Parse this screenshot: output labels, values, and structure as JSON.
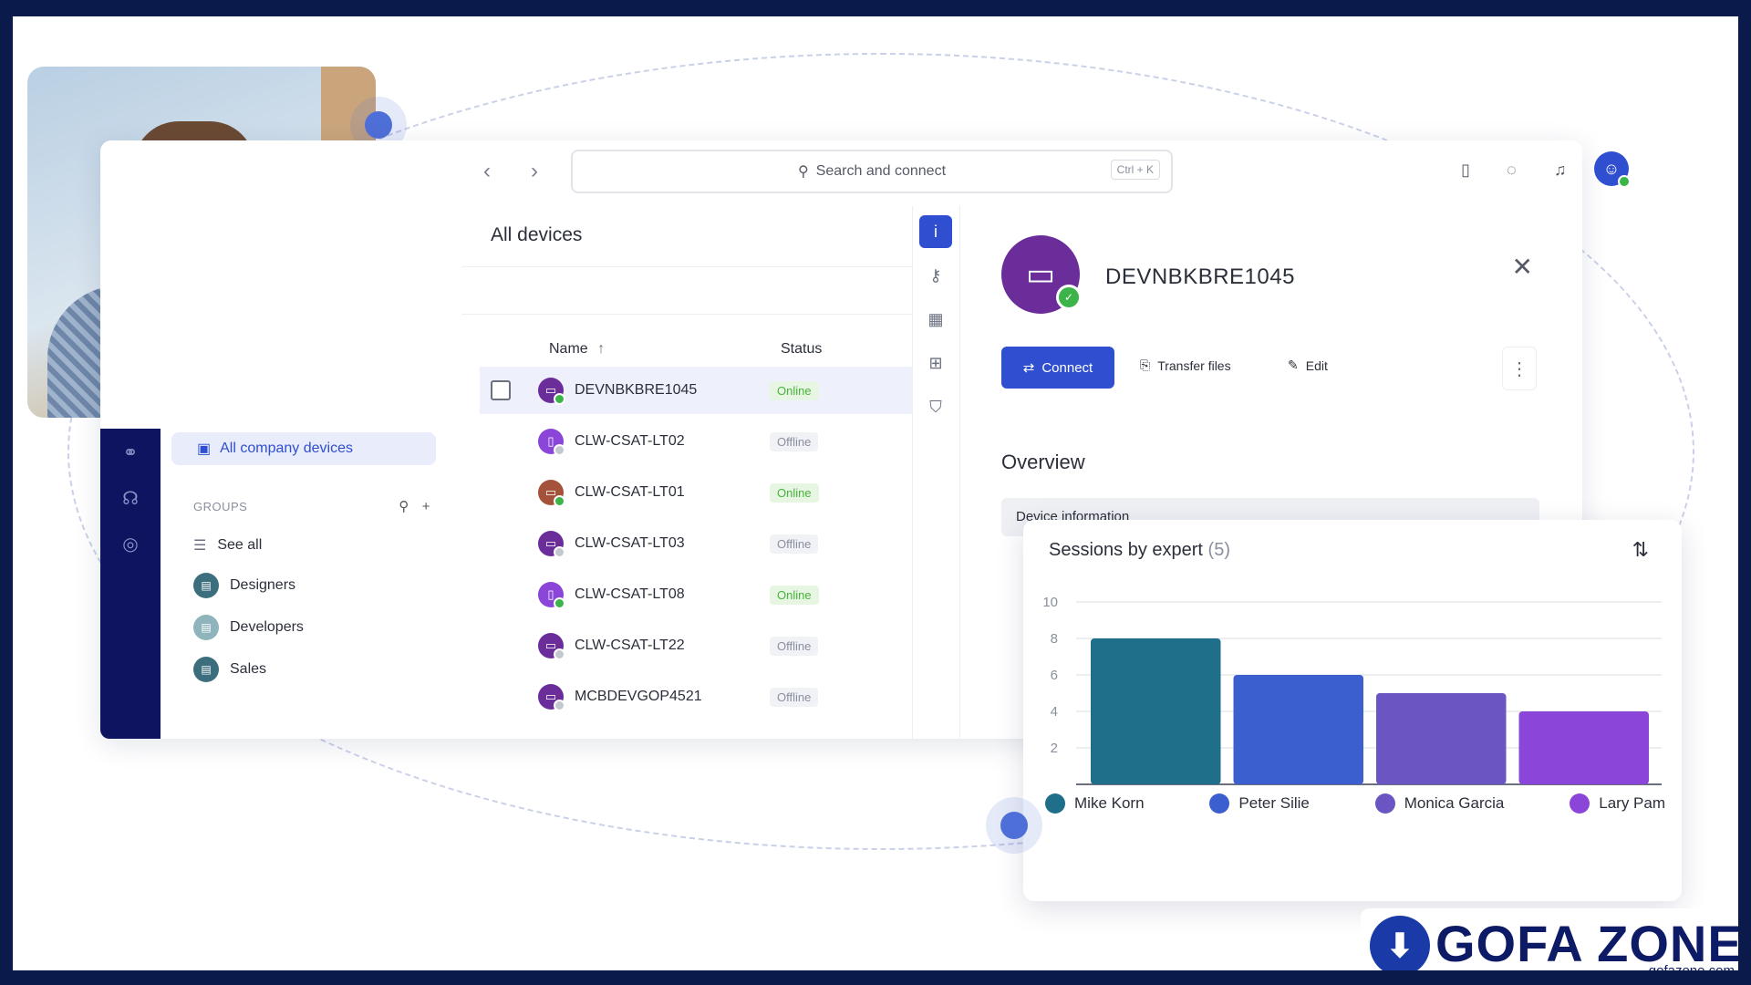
{
  "top": {
    "search_placeholder": "Search and connect",
    "search_shortcut": "Ctrl + K"
  },
  "sidebar": {
    "active_item": "All company devices",
    "groups_label": "GROUPS",
    "see_all": "See all",
    "groups": [
      {
        "label": "Designers"
      },
      {
        "label": "Developers"
      },
      {
        "label": "Sales"
      }
    ]
  },
  "devices": {
    "title": "All devices",
    "col_name": "Name",
    "col_status": "Status",
    "rows": [
      {
        "name": "DEVNBKBRE1045",
        "status": "Online",
        "online": true
      },
      {
        "name": "CLW-CSAT-LT02",
        "status": "Offline",
        "online": false
      },
      {
        "name": "CLW-CSAT-LT01",
        "status": "Online",
        "online": true
      },
      {
        "name": "CLW-CSAT-LT03",
        "status": "Offline",
        "online": false
      },
      {
        "name": "CLW-CSAT-LT08",
        "status": "Online",
        "online": true
      },
      {
        "name": "CLW-CSAT-LT22",
        "status": "Offline",
        "online": false
      },
      {
        "name": "MCBDEVGOP4521",
        "status": "Offline",
        "online": false
      }
    ]
  },
  "detail": {
    "device_name": "DEVNBKBRE1045",
    "connect_label": "Connect",
    "transfer_label": "Transfer files",
    "edit_label": "Edit",
    "overview_label": "Overview",
    "devinfo_label": "Device information"
  },
  "chart_data": {
    "type": "bar",
    "title": "Sessions by expert",
    "count_label": "(5)",
    "categories": [
      "Mike Korn",
      "Peter Silie",
      "Monica Garcia",
      "Lary Pam"
    ],
    "values": [
      8,
      6,
      5,
      4
    ],
    "colors": [
      "#1f6f8b",
      "#3c5fcf",
      "#6b55c2",
      "#8b45d8"
    ],
    "ylim": [
      0,
      10
    ],
    "yticks": [
      2,
      4,
      6,
      8,
      10
    ],
    "grid": true,
    "legend": "bottom"
  },
  "watermark": {
    "brand": "GOFA ZONE",
    "url": "gofazone.com"
  },
  "icons": {
    "back": "chevron-left-icon",
    "forward": "chevron-right-icon"
  }
}
